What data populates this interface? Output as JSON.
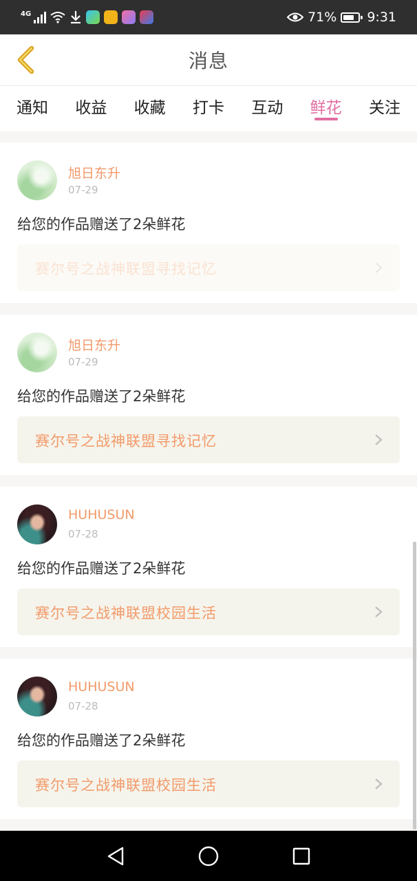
{
  "status_bar": {
    "network": "4G",
    "battery": "71%",
    "battery_level": 0.71,
    "time": "9:31",
    "icons": [
      "signal-icon",
      "wifi-icon",
      "download-icon",
      "video-app-icon",
      "game-app-icon",
      "camera-app-icon",
      "tv-app-icon",
      "eye-icon",
      "battery-icon"
    ]
  },
  "header": {
    "title": "消息",
    "back_icon": "chevron-left-icon"
  },
  "tabs": [
    {
      "label": "通知",
      "active": false
    },
    {
      "label": "收益",
      "active": false
    },
    {
      "label": "收藏",
      "active": false
    },
    {
      "label": "打卡",
      "active": false
    },
    {
      "label": "互动",
      "active": false
    },
    {
      "label": "鲜花",
      "active": true
    },
    {
      "label": "关注",
      "active": false
    }
  ],
  "colors": {
    "accent_tab": "#e06ea2",
    "username": "#f29a6a",
    "work_title": "#f29a6a"
  },
  "messages": [
    {
      "user": "旭日东升",
      "date": "07-29",
      "text": "给您的作品赠送了2朵鲜花",
      "work": "赛尔号之战神联盟寻找记忆",
      "avatar": "green"
    },
    {
      "user": "旭日东升",
      "date": "07-29",
      "text": "给您的作品赠送了2朵鲜花",
      "work": "赛尔号之战神联盟寻找记忆",
      "avatar": "green"
    },
    {
      "user": "HUHUSUN",
      "date": "07-28",
      "text": "给您的作品赠送了2朵鲜花",
      "work": "赛尔号之战神联盟校园生活",
      "avatar": "photo"
    },
    {
      "user": "HUHUSUN",
      "date": "07-28",
      "text": "给您的作品赠送了2朵鲜花",
      "work": "赛尔号之战神联盟校园生活",
      "avatar": "photo"
    }
  ],
  "nav": [
    "back-triangle-icon",
    "home-circle-icon",
    "recents-square-icon"
  ]
}
